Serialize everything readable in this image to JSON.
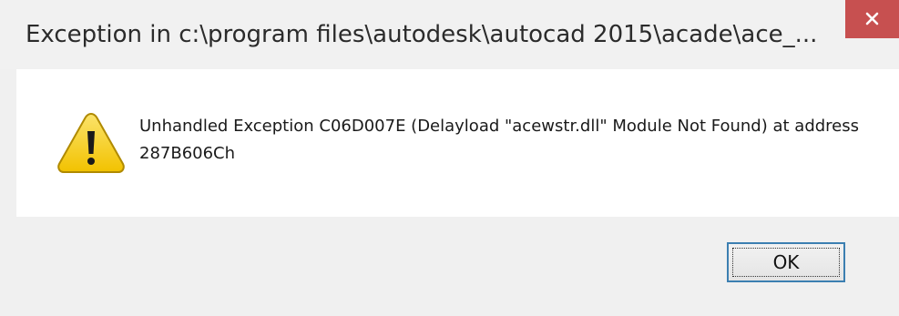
{
  "dialog": {
    "title": "Exception in c:\\program files\\autodesk\\autocad 2015\\acade\\ace_...",
    "close_icon": "close-icon",
    "warning_icon": "warning-icon",
    "message": "Unhandled Exception C06D007E (Delayload \"acewstr.dll\" Module Not Found) at address 287B606Ch",
    "ok_label": "OK"
  },
  "colors": {
    "close_button": "#c75050",
    "warning_yellow": "#f7d21a",
    "focus_border": "#3c7fb1"
  }
}
